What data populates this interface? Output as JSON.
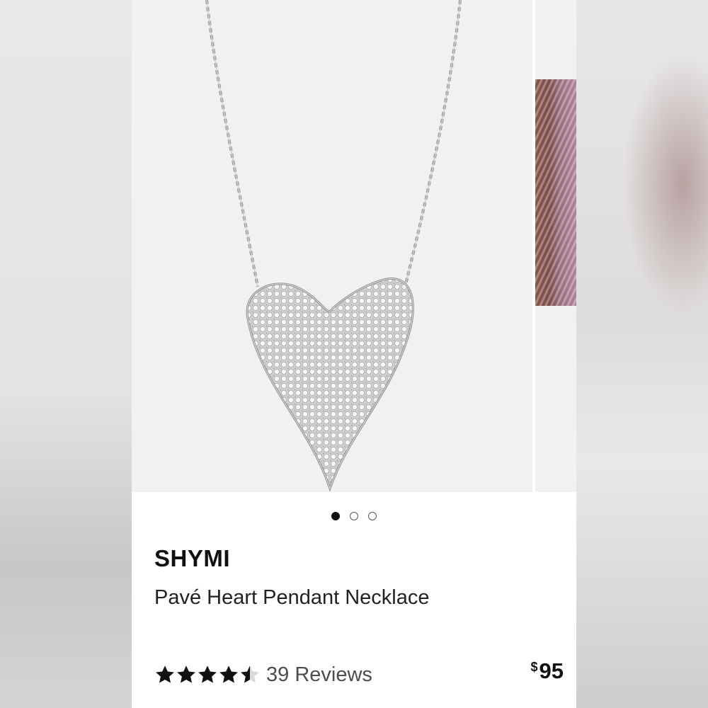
{
  "product": {
    "brand": "SHYMI",
    "name": "Pavé Heart Pendant Necklace",
    "rating": 4.5,
    "rating_max": 5,
    "review_count": "39 Reviews",
    "price_currency": "$",
    "price_value": "95"
  },
  "carousel": {
    "slide_count": 3,
    "active_index": 0
  },
  "colors": {
    "star_filled": "#111111",
    "star_empty": "#d9d9d9",
    "image_bg": "#f1f1f1",
    "text_primary": "#111111"
  },
  "icons": {
    "star": "star-icon",
    "dot": "carousel-dot"
  }
}
